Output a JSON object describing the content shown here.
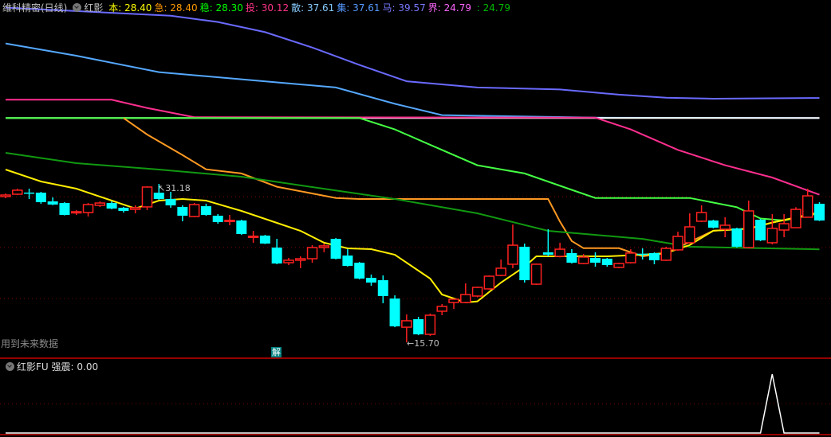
{
  "header": {
    "title": "维科精密(日线)",
    "indicator": "红影",
    "values": [
      {
        "label": "本",
        "value": "28.40",
        "color": "#ffff00"
      },
      {
        "label": "急",
        "value": "28.40",
        "color": "#ff9900"
      },
      {
        "label": "稳",
        "value": "28.30",
        "color": "#00ff00"
      },
      {
        "label": "投",
        "value": "30.12",
        "color": "#ff3388"
      },
      {
        "label": "散",
        "value": "37.61",
        "color": "#88ccff"
      },
      {
        "label": "集",
        "value": "37.61",
        "color": "#5599ff"
      },
      {
        "label": "马",
        "value": "39.57",
        "color": "#7777ff"
      },
      {
        "label": "界",
        "value": "24.79",
        "color": "#ff66ff"
      },
      {
        "label": "",
        "value": "24.79",
        "color": "#00bb00"
      }
    ]
  },
  "warning": "用到未来数据",
  "jie_badge": "解",
  "lower_panel": {
    "title": "红影FU",
    "label": "强震",
    "value": "0.00"
  },
  "chart_data": [
    {
      "type": "candlestick",
      "title": "维科精密(日线)",
      "annotations": [
        {
          "label": "31.18",
          "index": 13,
          "kind": "high"
        },
        {
          "label": "15.70",
          "index": 34,
          "kind": "low"
        }
      ],
      "grid": true,
      "colors": {
        "up": "#ff2020",
        "down": "#00ffff"
      },
      "ohlc_fields": [
        "open",
        "close",
        "high",
        "low"
      ],
      "candles": [
        [
          29.94,
          30.09,
          30.24,
          29.78
        ],
        [
          30.17,
          30.56,
          30.71,
          30.09
        ],
        [
          30.33,
          30.32,
          30.71,
          29.7
        ],
        [
          30.32,
          29.39,
          30.4,
          29.24
        ],
        [
          29.47,
          29.16,
          29.86,
          29.1
        ],
        [
          29.31,
          28.15,
          29.4,
          28.1
        ],
        [
          28.38,
          28.46,
          28.61,
          28.15
        ],
        [
          28.38,
          29.16,
          29.31,
          27.99
        ],
        [
          29.08,
          29.31,
          29.47,
          28.93
        ],
        [
          29.31,
          28.77,
          29.47,
          28.7
        ],
        [
          28.85,
          28.54,
          28.93,
          28.38
        ],
        [
          28.69,
          28.85,
          29.08,
          28.3
        ],
        [
          28.93,
          30.87,
          30.95,
          28.61
        ],
        [
          30.32,
          29.7,
          31.18,
          29.62
        ],
        [
          29.7,
          29.08,
          30.4,
          28.85
        ],
        [
          28.93,
          28.07,
          29.08,
          27.53
        ],
        [
          27.99,
          29.16,
          29.31,
          27.92
        ],
        [
          29.0,
          28.15,
          29.24,
          28.07
        ],
        [
          28.07,
          27.45,
          28.23,
          27.29
        ],
        [
          27.58,
          27.62,
          28.15,
          27.14
        ],
        [
          27.6,
          26.28,
          27.68,
          26.2
        ],
        [
          26.03,
          26.07,
          26.59,
          25.43
        ],
        [
          26.13,
          25.35,
          26.2,
          25.3
        ],
        [
          24.96,
          23.4,
          25.81,
          23.33
        ],
        [
          23.48,
          23.72,
          23.95,
          23.25
        ],
        [
          23.72,
          23.87,
          24.1,
          22.94
        ],
        [
          23.87,
          24.96,
          25.19,
          23.48
        ],
        [
          24.96,
          25.12,
          25.35,
          24.49
        ],
        [
          25.81,
          23.87,
          25.89,
          23.8
        ],
        [
          24.18,
          23.17,
          24.8,
          23.1
        ],
        [
          23.48,
          21.93,
          23.55,
          21.85
        ],
        [
          22.0,
          21.54,
          22.32,
          21.23
        ],
        [
          21.77,
          20.22,
          22.24,
          19.52
        ],
        [
          19.98,
          17.26,
          20.29,
          17.18
        ],
        [
          17.18,
          17.81,
          18.43,
          15.7
        ],
        [
          17.96,
          16.48,
          18.19,
          16.4
        ],
        [
          16.48,
          18.35,
          18.51,
          16.33
        ],
        [
          18.74,
          19.21,
          19.44,
          18.35
        ],
        [
          19.59,
          19.91,
          19.98,
          18.97
        ],
        [
          19.59,
          20.37,
          21.46,
          19.52
        ],
        [
          20.22,
          21.07,
          21.15,
          20.1
        ],
        [
          20.92,
          22.16,
          22.24,
          20.85
        ],
        [
          22.24,
          22.94,
          23.79,
          22.16
        ],
        [
          23.33,
          25.19,
          27.21,
          22.94
        ],
        [
          25.04,
          21.77,
          25.35,
          21.54
        ],
        [
          21.38,
          23.33,
          23.4,
          21.3
        ],
        [
          24.49,
          24.26,
          26.75,
          24.1
        ],
        [
          24.1,
          24.8,
          25.43,
          24.0
        ],
        [
          24.42,
          23.48,
          24.8,
          23.4
        ],
        [
          23.4,
          24.03,
          24.34,
          23.33
        ],
        [
          23.95,
          23.48,
          24.49,
          23.09
        ],
        [
          23.87,
          23.25,
          23.95,
          23.09
        ],
        [
          23.02,
          23.4,
          23.48,
          22.94
        ],
        [
          23.48,
          24.42,
          24.8,
          23.4
        ],
        [
          24.36,
          24.32,
          24.88,
          23.79
        ],
        [
          24.42,
          23.72,
          24.49,
          23.33
        ],
        [
          23.72,
          24.88,
          25.04,
          23.65
        ],
        [
          24.73,
          26.05,
          26.51,
          24.65
        ],
        [
          25.43,
          26.98,
          28.3,
          25.35
        ],
        [
          27.53,
          28.38,
          29.08,
          27.45
        ],
        [
          27.6,
          26.9,
          27.68,
          26.83
        ],
        [
          26.75,
          27.14,
          27.92,
          25.97
        ],
        [
          26.83,
          25.04,
          26.9,
          24.96
        ],
        [
          24.96,
          28.54,
          29.55,
          24.88
        ],
        [
          27.68,
          25.66,
          27.76,
          25.58
        ],
        [
          25.43,
          26.83,
          28.23,
          25.27
        ],
        [
          26.67,
          27.29,
          28.23,
          25.97
        ],
        [
          26.9,
          28.69,
          28.9,
          26.9
        ],
        [
          27.92,
          30.01,
          30.71,
          27.9
        ],
        [
          29.24,
          27.6,
          29.39,
          27.55
        ]
      ],
      "series": [
        {
          "name": "马",
          "color": "#6a6aff",
          "points": [
            [
              0,
              48.4
            ],
            [
              14,
              47.6
            ],
            [
              18,
              47.0
            ],
            [
              22,
              46.0
            ],
            [
              26,
              44.5
            ],
            [
              30,
              42.8
            ],
            [
              34,
              41.2
            ],
            [
              40,
              40.6
            ],
            [
              47,
              40.4
            ],
            [
              52,
              39.9
            ],
            [
              56,
              39.6
            ],
            [
              60,
              39.5
            ],
            [
              69,
              39.57
            ]
          ]
        },
        {
          "name": "集",
          "color": "#55a8ff",
          "points": [
            [
              0,
              44.9
            ],
            [
              6,
              43.7
            ],
            [
              13,
              42.1
            ],
            [
              20,
              41.4
            ],
            [
              28,
              40.6
            ],
            [
              33,
              39.0
            ],
            [
              37,
              37.9
            ],
            [
              50,
              37.65
            ],
            [
              69,
              37.61
            ]
          ]
        },
        {
          "name": "散",
          "color": "#ffffff",
          "points": [
            [
              0,
              37.61
            ],
            [
              69,
              37.61
            ]
          ]
        },
        {
          "name": "投",
          "color": "#ff2f8f",
          "points": [
            [
              0,
              39.4
            ],
            [
              9,
              39.4
            ],
            [
              12,
              38.6
            ],
            [
              16,
              37.7
            ],
            [
              50,
              37.65
            ],
            [
              53,
              36.5
            ],
            [
              57,
              34.5
            ],
            [
              61,
              33.0
            ],
            [
              65,
              31.8
            ],
            [
              69,
              30.12
            ]
          ]
        },
        {
          "name": "稳",
          "color": "#44ff44",
          "points": [
            [
              0,
              37.61
            ],
            [
              30,
              37.61
            ],
            [
              33,
              36.5
            ],
            [
              36,
              35.0
            ],
            [
              40,
              33.0
            ],
            [
              44,
              32.2
            ],
            [
              48,
              30.6
            ],
            [
              50,
              29.8
            ],
            [
              58,
              29.8
            ],
            [
              62,
              28.9
            ],
            [
              64,
              27.8
            ],
            [
              66,
              27.6
            ],
            [
              69,
              28.3
            ]
          ]
        },
        {
          "name": "急",
          "color": "#ff9922",
          "points": [
            [
              10,
              37.61
            ],
            [
              12,
              36.0
            ],
            [
              15,
              34.0
            ],
            [
              17,
              32.6
            ],
            [
              20,
              32.2
            ],
            [
              23,
              30.9
            ],
            [
              28,
              29.8
            ],
            [
              30,
              29.7
            ],
            [
              46,
              29.7
            ],
            [
              47,
              27.5
            ],
            [
              48,
              25.6
            ],
            [
              49,
              24.9
            ],
            [
              52,
              24.9
            ],
            [
              54,
              24.1
            ],
            [
              56,
              24.4
            ],
            [
              58,
              25.5
            ],
            [
              60,
              26.6
            ],
            [
              63,
              26.8
            ],
            [
              65,
              27.4
            ],
            [
              69,
              28.4
            ]
          ]
        },
        {
          "name": "界",
          "color": "#119911",
          "points": [
            [
              0,
              34.21
            ],
            [
              6,
              33.2
            ],
            [
              13,
              32.58
            ],
            [
              20,
              31.88
            ],
            [
              26,
              30.87
            ],
            [
              33,
              29.7
            ],
            [
              40,
              28.3
            ],
            [
              46,
              26.59
            ],
            [
              54,
              25.81
            ],
            [
              58,
              25.04
            ],
            [
              69,
              24.79
            ]
          ]
        },
        {
          "name": "本",
          "color": "#ffee00",
          "points": [
            [
              0,
              32.58
            ],
            [
              3,
              31.41
            ],
            [
              6,
              30.71
            ],
            [
              9,
              29.55
            ],
            [
              11,
              28.77
            ],
            [
              13,
              29.55
            ],
            [
              15,
              29.7
            ],
            [
              17,
              29.55
            ],
            [
              20,
              28.54
            ],
            [
              23,
              27.37
            ],
            [
              25,
              26.59
            ],
            [
              27,
              25.43
            ],
            [
              29,
              24.88
            ],
            [
              31,
              24.8
            ],
            [
              33,
              24.26
            ],
            [
              36,
              21.93
            ],
            [
              37,
              20.37
            ],
            [
              39,
              19.59
            ],
            [
              40,
              19.7
            ],
            [
              42,
              21.54
            ],
            [
              44,
              23.09
            ],
            [
              45,
              24.1
            ],
            [
              51,
              24.1
            ],
            [
              54,
              24.26
            ],
            [
              56,
              24.42
            ],
            [
              58,
              25.2
            ],
            [
              60,
              26.6
            ],
            [
              63,
              26.8
            ],
            [
              65,
              27.4
            ],
            [
              69,
              28.4
            ]
          ]
        }
      ]
    },
    {
      "type": "line",
      "title": "红影FU 强震",
      "ylim": [
        0,
        1
      ],
      "series": [
        {
          "name": "强震",
          "color": "#ffffff",
          "points": [
            [
              0,
              0
            ],
            [
              64,
              0
            ],
            [
              65,
              1
            ],
            [
              66,
              0
            ],
            [
              69,
              0
            ]
          ]
        }
      ]
    }
  ]
}
